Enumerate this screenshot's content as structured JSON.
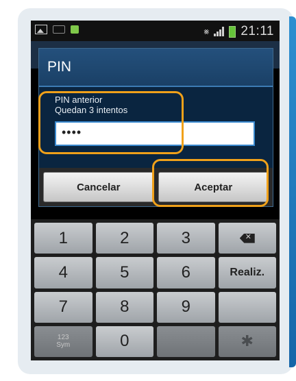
{
  "status_bar": {
    "time": "21:11"
  },
  "dialog": {
    "title": "PIN",
    "label_line1": "PIN anterior",
    "label_line2": "Quedan 3 intentos",
    "pin_value": "••••",
    "cancel_label": "Cancelar",
    "accept_label": "Aceptar"
  },
  "keyboard": {
    "row1": [
      "1",
      "2",
      "3"
    ],
    "row2": [
      "4",
      "5",
      "6"
    ],
    "row3": [
      "7",
      "8",
      "9"
    ],
    "sym_label_line1": "123",
    "sym_label_line2": "Sym",
    "zero": "0",
    "done_label": "Realiz."
  },
  "icons": [
    "gallery-icon",
    "keyboard-icon",
    "usb-icon",
    "no-sound-icon",
    "signal-icon",
    "battery-icon",
    "backspace-icon",
    "settings-icon"
  ],
  "colors": {
    "highlight": "#f0a11a",
    "dialog_title_bg": "#1a4066",
    "input_border": "#3a8ad0"
  }
}
